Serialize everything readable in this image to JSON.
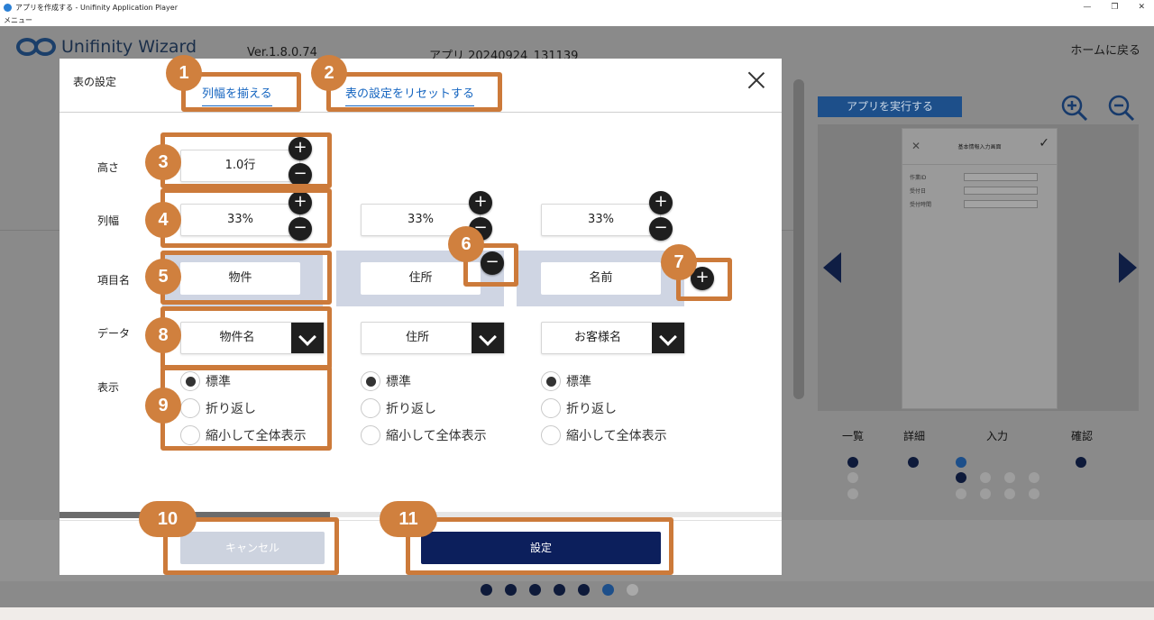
{
  "window": {
    "title": "アプリを作成する - Unifinity Application Player",
    "minimize": "—",
    "restore": "❐",
    "close": "✕",
    "menu": "メニュー"
  },
  "app": {
    "logo_text": "Unifinity Wizard",
    "version": "Ver.1.8.0.74",
    "app_name": "アプリ  20240924_131139",
    "home_link": "ホームに戻る",
    "run_button": "アプリを実行する",
    "preview": {
      "screen_title": "基本情報入力画面",
      "save_label": "情報する",
      "rows": [
        {
          "label": "作業ID"
        },
        {
          "label": "受付日"
        },
        {
          "label": "受付時間"
        }
      ]
    },
    "steps": [
      "一覧",
      "詳細",
      "入力",
      "確認"
    ]
  },
  "modal": {
    "title": "表の設定",
    "align_columns": "列幅を揃える",
    "reset_table": "表の設定をリセットする",
    "labels": {
      "height": "高さ",
      "col_width": "列幅",
      "item_name": "項目名",
      "data": "データ",
      "display": "表示"
    },
    "height_value": "1.0行",
    "columns": [
      {
        "width": "33%",
        "name": "物件",
        "data": "物件名",
        "display_selected": 0
      },
      {
        "width": "33%",
        "name": "住所",
        "data": "住所",
        "display_selected": 0
      },
      {
        "width": "33%",
        "name": "名前",
        "data": "お客様名",
        "display_selected": 0
      }
    ],
    "display_options": [
      "標準",
      "折り返し",
      "縮小して全体表示"
    ],
    "cancel": "キャンセル",
    "ok": "設定"
  },
  "callouts": [
    "1",
    "2",
    "3",
    "4",
    "5",
    "6",
    "7",
    "8",
    "9",
    "10",
    "11"
  ],
  "colors": {
    "callout": "#cc7a3a",
    "primary": "#0c1f5c",
    "link": "#1565c0"
  }
}
